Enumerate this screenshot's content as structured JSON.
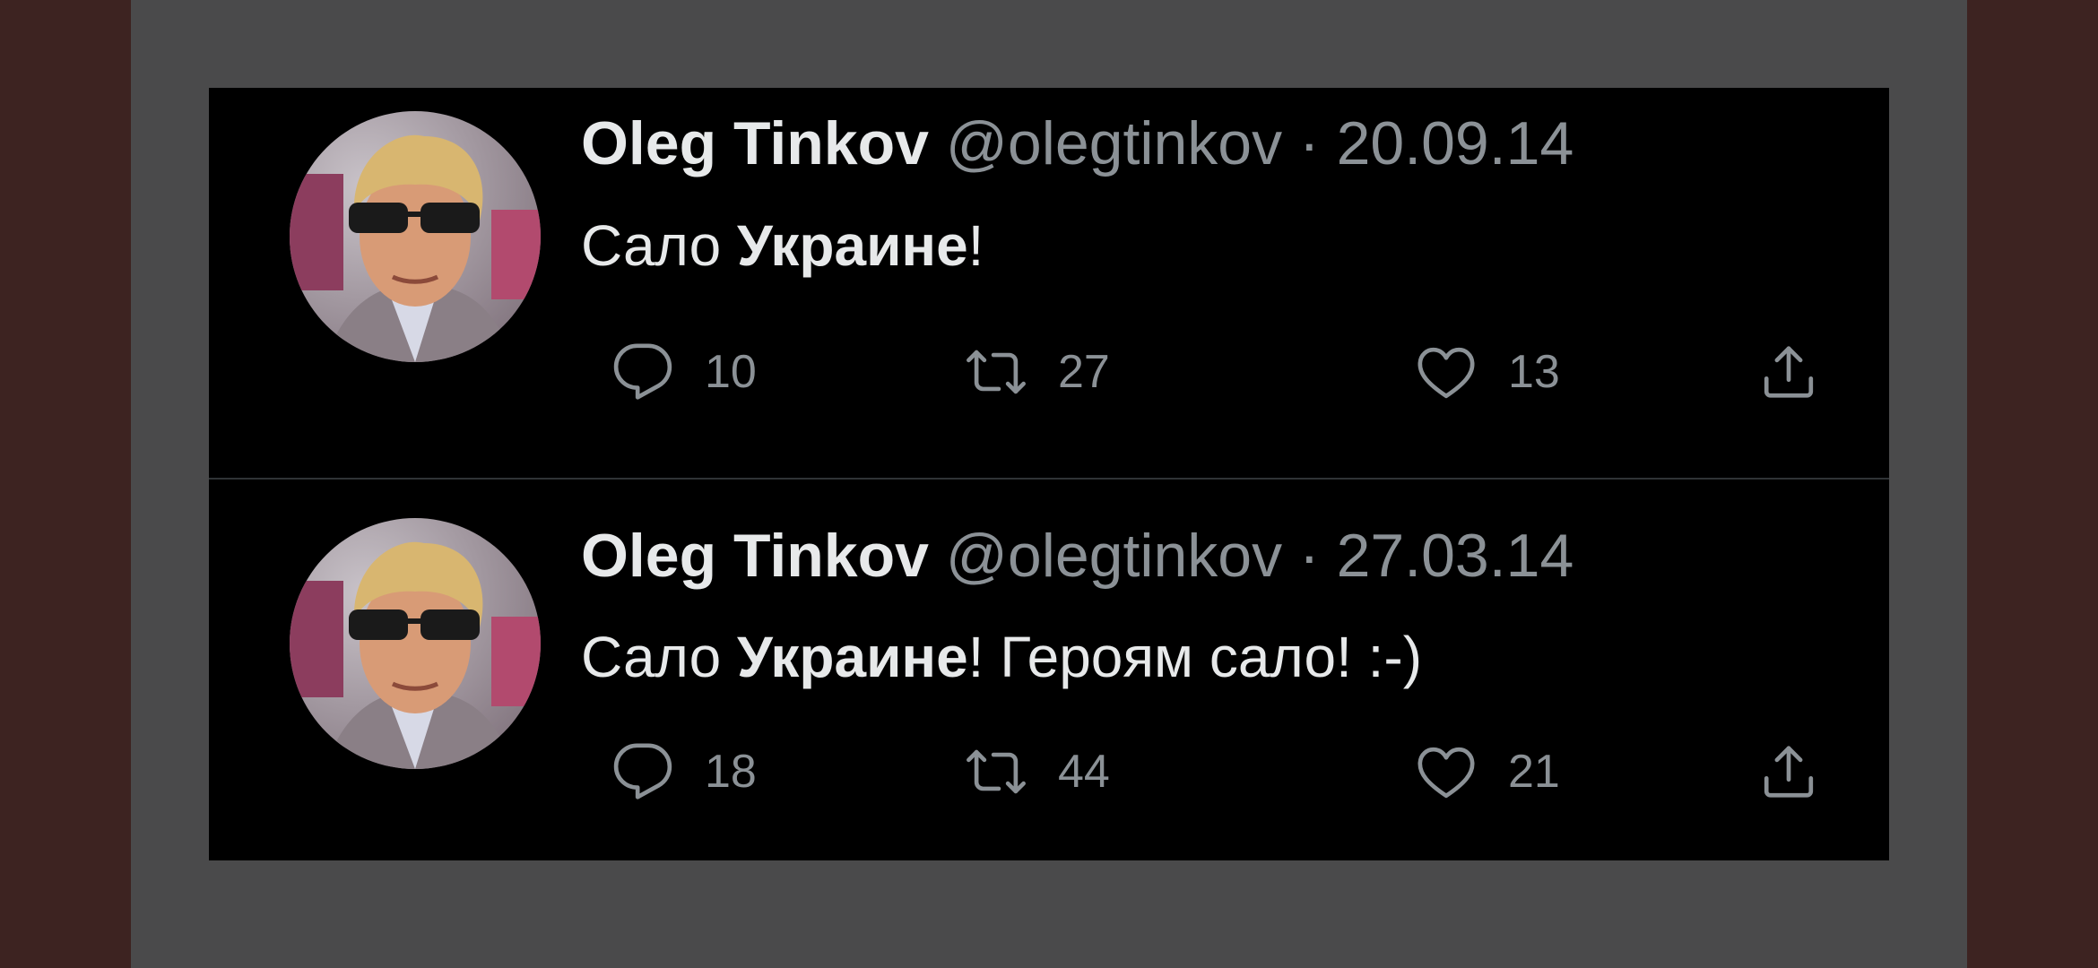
{
  "tweets": [
    {
      "author_name": "Oleg Tinkov",
      "handle": "@olegtinkov",
      "separator": "·",
      "date": "20.09.14",
      "text_regular_1": "Сало ",
      "text_bold": "Украине",
      "text_regular_2": "!",
      "counts": {
        "replies": "10",
        "retweets": "27",
        "likes": "13"
      }
    },
    {
      "author_name": "Oleg Tinkov",
      "handle": "@olegtinkov",
      "separator": "·",
      "date": "27.03.14",
      "text_regular_1": "Сало ",
      "text_bold": "Украине",
      "text_regular_2": "! Героям сало! :-)",
      "counts": {
        "replies": "18",
        "retweets": "44",
        "likes": "21"
      }
    }
  ],
  "icons": {
    "reply": "reply-bubble-icon",
    "retweet": "retweet-arrows-icon",
    "like": "heart-icon",
    "share": "share-upload-icon"
  },
  "colors": {
    "frame_background": "#3d2321",
    "panel_gray": "#4a4a4b",
    "card_background": "#000000",
    "primary_text": "#e7e9ea",
    "secondary_text": "#8b9196",
    "divider": "#2f3336"
  }
}
